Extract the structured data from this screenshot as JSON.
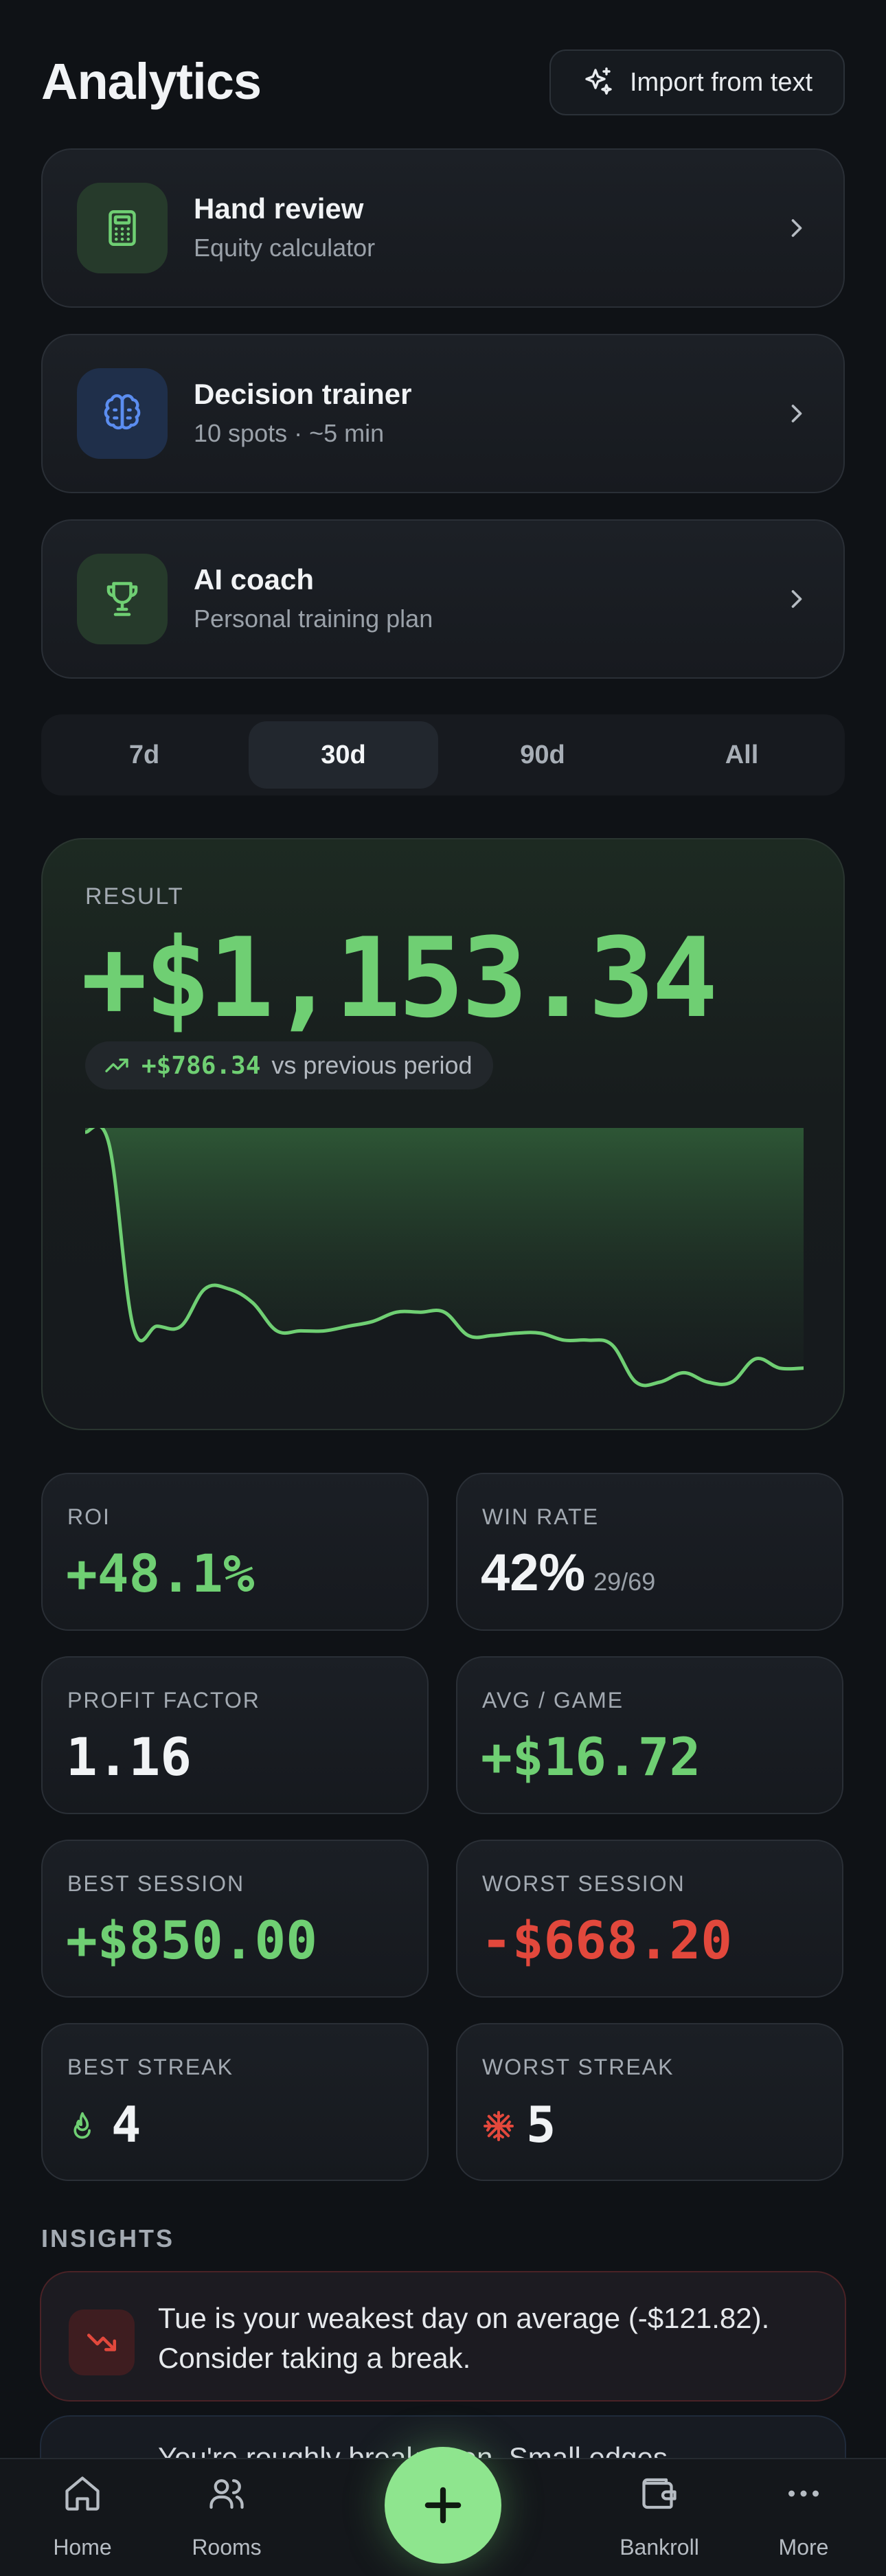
{
  "header": {
    "title": "Analytics",
    "import_label": "Import from text"
  },
  "tools": [
    {
      "title": "Hand review",
      "subtitle": "Equity calculator",
      "icon": "calculator-icon"
    },
    {
      "title": "Decision trainer",
      "subtitle": "10 spots · ~5 min",
      "icon": "brain-icon"
    },
    {
      "title": "AI coach",
      "subtitle": "Personal training plan",
      "icon": "trophy-icon"
    }
  ],
  "periods": {
    "options": [
      "7d",
      "30d",
      "90d",
      "All"
    ],
    "selected": "30d"
  },
  "result": {
    "label": "RESULT",
    "value": "+$1,153.34",
    "delta_value": "+$786.34",
    "delta_text": "vs previous period"
  },
  "chart_data": {
    "type": "area",
    "x": [
      0,
      1,
      2,
      3,
      4,
      5,
      6,
      7,
      8,
      9,
      10,
      11,
      12,
      13,
      14,
      15,
      16,
      17,
      18,
      19,
      20,
      21,
      22,
      23,
      24,
      25,
      26,
      27,
      28,
      29,
      30
    ],
    "series": [
      {
        "values": [
          1153,
          1100,
          320,
          320,
          320,
          480,
          480,
          420,
          300,
          300,
          300,
          320,
          340,
          380,
          380,
          380,
          280,
          280,
          290,
          290,
          260,
          260,
          240,
          80,
          80,
          120,
          80,
          80,
          180,
          140,
          140
        ]
      }
    ],
    "color": "#6fcf73",
    "grid": false
  },
  "stats": {
    "roi": {
      "label": "ROI",
      "value": "+48.1%"
    },
    "win_rate": {
      "label": "WIN RATE",
      "value": "42%",
      "sub": "29/69"
    },
    "profit_factor": {
      "label": "PROFIT FACTOR",
      "value": "1.16"
    },
    "avg_game": {
      "label": "AVG / GAME",
      "value": "+$16.72"
    },
    "best_session": {
      "label": "BEST SESSION",
      "value": "+$850.00"
    },
    "worst_session": {
      "label": "WORST SESSION",
      "value": "-$668.20"
    },
    "best_streak": {
      "label": "BEST STREAK",
      "value": "4",
      "icon": "flame-icon"
    },
    "worst_streak": {
      "label": "WORST STREAK",
      "value": "5",
      "icon": "snowflake-icon"
    }
  },
  "insights": {
    "title": "INSIGHTS",
    "items": [
      {
        "text": "Tue is your weakest day on average (-$121.82). Consider taking a break.",
        "icon": "trending-down-icon"
      },
      {
        "text": "You're roughly break-even. Small edges",
        "icon": "info-icon"
      }
    ]
  },
  "nav": {
    "home": "Home",
    "rooms": "Rooms",
    "bankroll": "Bankroll",
    "more": "More"
  },
  "colors": {
    "accent_green": "#6fcf73",
    "negative_red": "#e2483c",
    "fab_green": "#8ee58e"
  }
}
